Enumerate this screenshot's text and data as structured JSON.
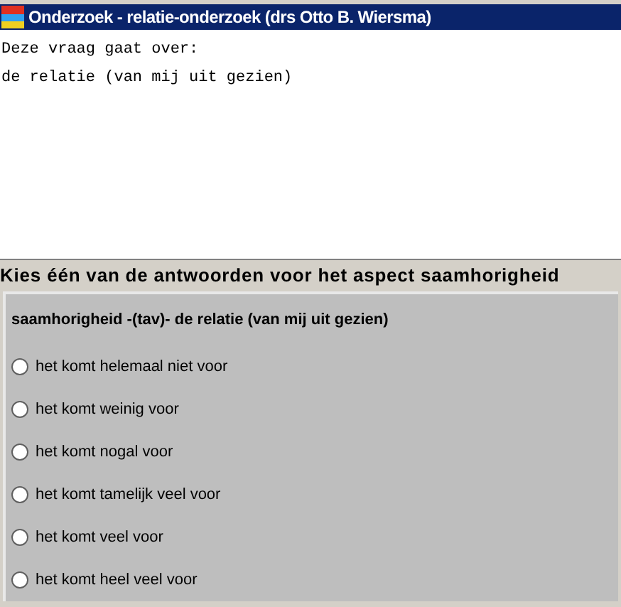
{
  "window": {
    "title": "Onderzoek - relatie-onderzoek (drs Otto B. Wiersma)"
  },
  "intro": [
    "Deze vraag gaat over:",
    "de relatie (van mij uit gezien)"
  ],
  "heading": "Kies één van de antwoorden voor het aspect saamhorigheid",
  "question": "saamhorigheid -(tav)- de relatie (van mij uit gezien)",
  "options": [
    {
      "label": "het komt helemaal niet voor",
      "selected": false
    },
    {
      "label": "het komt weinig voor",
      "selected": false
    },
    {
      "label": "het komt nogal voor",
      "selected": false
    },
    {
      "label": "het komt tamelijk veel voor",
      "selected": false
    },
    {
      "label": "het komt veel voor",
      "selected": false
    },
    {
      "label": "het komt heel veel voor",
      "selected": false
    }
  ]
}
